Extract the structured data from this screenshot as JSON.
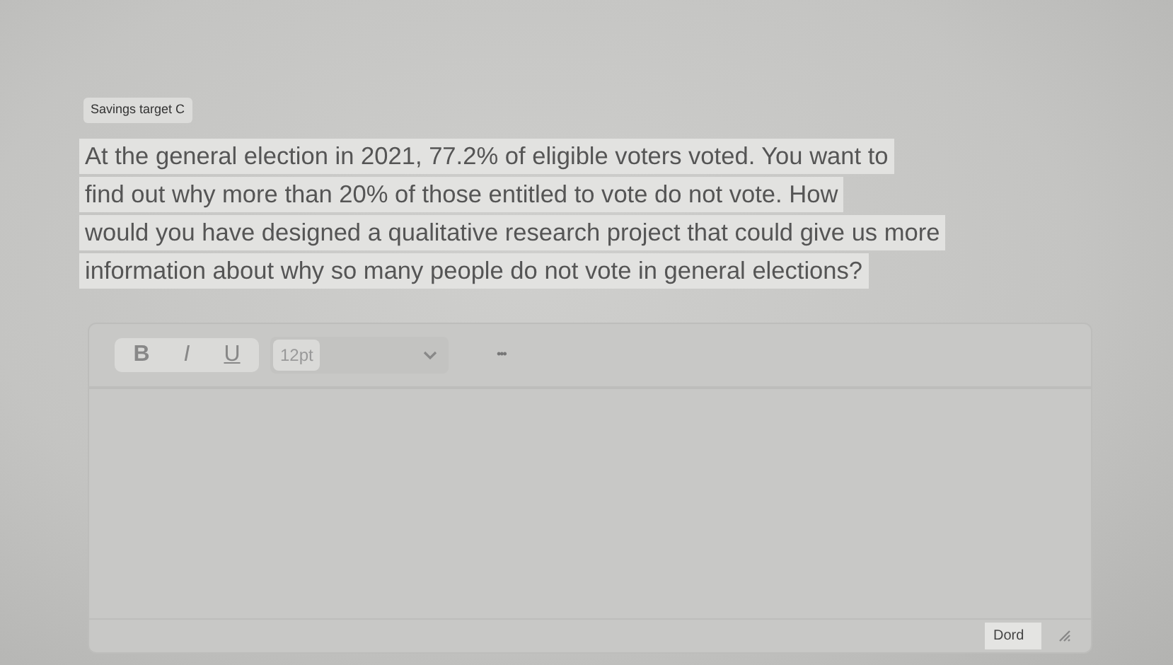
{
  "tag": "Savings target C",
  "question_lines": [
    "At the general election in 2021, 77.2% of eligible voters voted. You want to",
    "find out why more than 20% of those entitled to vote do not vote. How",
    "would you have designed a qualitative research project that could give us more",
    "information about why so many people do not vote in general elections?"
  ],
  "toolbar": {
    "format_buttons": [
      {
        "label": "B",
        "kind": "bold"
      },
      {
        "label": "I",
        "kind": "italic"
      },
      {
        "label": "U",
        "kind": "underline"
      }
    ],
    "font_size": "12pt",
    "more": "•••"
  },
  "status_bar": {
    "word_count": "Dord"
  }
}
